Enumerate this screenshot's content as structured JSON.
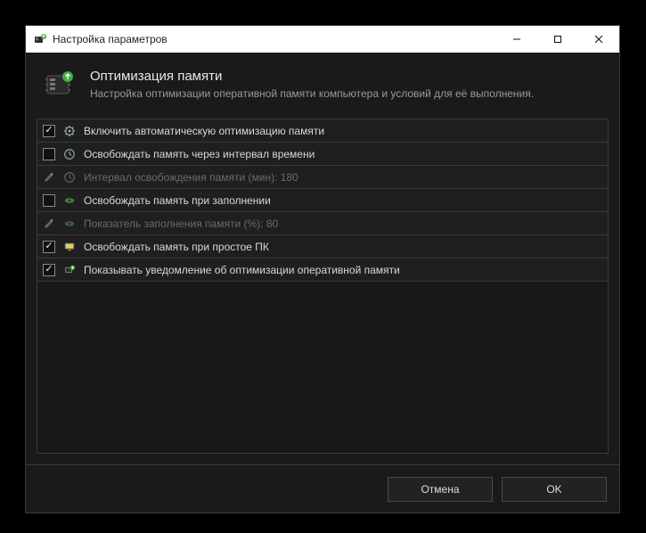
{
  "window": {
    "title": "Настройка параметров"
  },
  "header": {
    "title": "Оптимизация памяти",
    "subtitle": "Настройка оптимизации оперативной памяти компьютера и условий для её выполнения."
  },
  "rows": [
    {
      "label": "Включить автоматическую оптимизацию памяти",
      "checked": true,
      "type": "check",
      "icon": "gear"
    },
    {
      "label": "Освобождать память через интервал времени",
      "checked": false,
      "type": "check",
      "icon": "clock"
    },
    {
      "label": "Интервал освобождения памяти (мин): 180",
      "checked": false,
      "type": "edit",
      "icon": "clock",
      "disabled": true
    },
    {
      "label": "Освобождать память при заполнении",
      "checked": false,
      "type": "check",
      "icon": "disk"
    },
    {
      "label": "Показатель заполнения памяти (%): 80",
      "checked": false,
      "type": "edit",
      "icon": "disk",
      "disabled": true
    },
    {
      "label": "Освобождать память при простое ПК",
      "checked": true,
      "type": "check",
      "icon": "monitor"
    },
    {
      "label": "Показывать уведомление об оптимизации оперативной памяти",
      "checked": true,
      "type": "check",
      "icon": "notify"
    }
  ],
  "footer": {
    "cancel": "Отмена",
    "ok": "OK"
  }
}
